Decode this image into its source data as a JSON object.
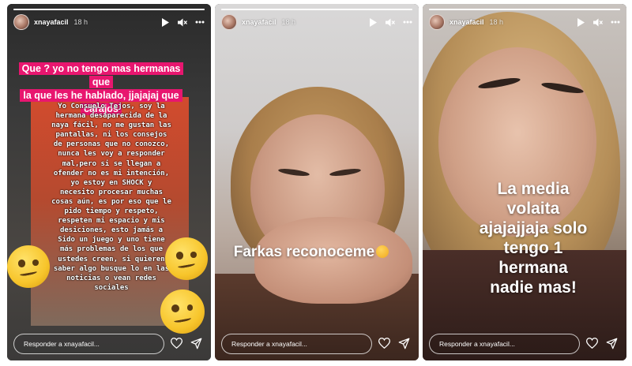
{
  "stories": [
    {
      "username": "xnayafacil",
      "time": "18 h",
      "reply_placeholder": "Responder a xnayafacil...",
      "caption_lines": [
        "Que ? yo no tengo mas hermanas que",
        "la que les he hablado, jjajajaj que",
        "carajos"
      ],
      "letter_lines": [
        "Yo Consuelo Tejos, soy la",
        "hermana desaparecida de la",
        "naya fácil, no me gustan las",
        "pantallas, ni los consejos",
        "de personas que no conozco,",
        "nunca les voy a responder",
        "mal,pero si se llegan a",
        "ofender no es mi intención,",
        "yo estoy en SHOCK y",
        "necesito procesar muchas",
        "cosas aún, es por eso que le",
        "pido tiempo y respeto,",
        "respeten mi espacio y mis",
        "desiciones, esto jamás a",
        "Sido un juego y uno tiene",
        "más problemas de los que",
        "ustedes creen, si quieren",
        "saber algo busque lo en las",
        "noticias o vean redes",
        "sociales"
      ]
    },
    {
      "username": "xnayafacil",
      "time": "18 h",
      "reply_placeholder": "Responder a xnayafacil...",
      "caption": "Farkas reconoceme"
    },
    {
      "username": "xnayafacil",
      "time": "18 h",
      "reply_placeholder": "Responder a xnayafacil...",
      "caption_lines": [
        "La media",
        "volaita",
        "ajajajjaja solo",
        "tengo 1",
        "hermana",
        "nadie mas!"
      ]
    }
  ],
  "icons": {
    "play": "play-icon",
    "mute": "volume-mute-icon",
    "more": "more-icon",
    "heart": "heart-icon",
    "send": "send-icon",
    "emoji": "woozy-face-emoji",
    "cat_emoji": "pouting-cat-emoji"
  },
  "colors": {
    "caption_highlight": "#e8166f"
  }
}
